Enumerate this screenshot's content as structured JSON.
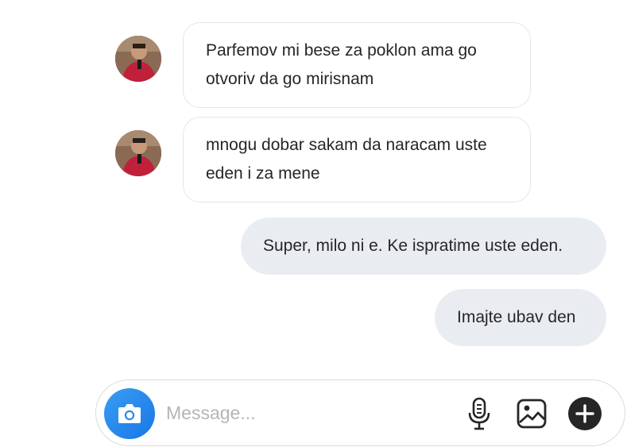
{
  "messages": [
    {
      "direction": "incoming",
      "lines": [
        "Parfemov mi bese za poklon ama go",
        "otvoriv da go mirisnam"
      ]
    },
    {
      "direction": "incoming",
      "lines": [
        "mnogu dobar sakam da naracam uste",
        "eden i za mene"
      ]
    },
    {
      "direction": "outgoing",
      "text": "Super, milo ni e. Ke ispratime uste eden."
    },
    {
      "direction": "outgoing",
      "text": "Imajte ubav den"
    }
  ],
  "composer": {
    "placeholder": "Message...",
    "icons": [
      "camera-icon",
      "microphone-icon",
      "image-icon",
      "plus-icon"
    ]
  },
  "colors": {
    "outgoing_bubble": "#e9edf1",
    "incoming_border": "#e6e6e6",
    "camera_button": "#1877e6",
    "placeholder_text": "#b5b5b5"
  }
}
